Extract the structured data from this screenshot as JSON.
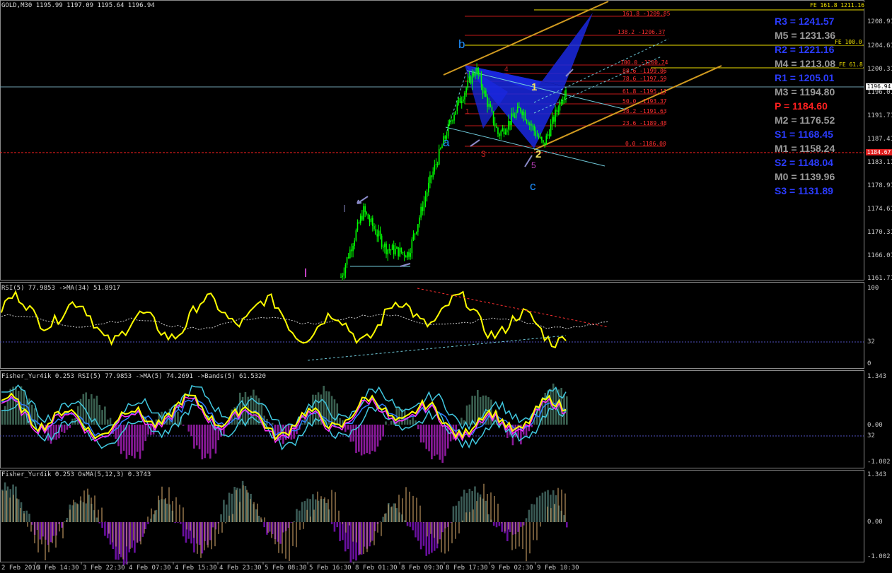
{
  "header": {
    "title": "GOLD,M30  1195.99 1197.09 1195.64 1196.94"
  },
  "colors": {
    "background": "#000000",
    "candle": "#00ff00",
    "pivot_blue": "#1e3cff",
    "pivot_gray": "#a0a0a0",
    "pivot_red": "#ff2020",
    "rsi_line": "#ffff00",
    "channel": "#e0a020",
    "fib": "#ff2020",
    "harmonic_fill": "#1a28e0"
  },
  "pivots": [
    {
      "label": "R3 = 1241.57",
      "color": "#2b3cff"
    },
    {
      "label": "M5 = 1231.36",
      "color": "#9a9a9a"
    },
    {
      "label": "R2 = 1221.16",
      "color": "#2b3cff"
    },
    {
      "label": "M4 = 1213.08",
      "color": "#9a9a9a"
    },
    {
      "label": "R1 = 1205.01",
      "color": "#2b3cff"
    },
    {
      "label": "M3 = 1194.80",
      "color": "#9a9a9a"
    },
    {
      "label": "P   = 1184.60",
      "color": "#ff2020"
    },
    {
      "label": "M2 = 1176.52",
      "color": "#9a9a9a"
    },
    {
      "label": "S1 = 1168.45",
      "color": "#2b3cff"
    },
    {
      "label": "M1 = 1158.24",
      "color": "#9a9a9a"
    },
    {
      "label": "S2 = 1148.04",
      "color": "#2b3cff"
    },
    {
      "label": "M0 = 1139.96",
      "color": "#9a9a9a"
    },
    {
      "label": "S3 = 1131.89",
      "color": "#2b3cff"
    }
  ],
  "fe_labels": [
    {
      "text": "FE  161.8  1211.16"
    },
    {
      "text": "FE  100.0"
    },
    {
      "text": "FE  61.8"
    }
  ],
  "fib_levels": [
    {
      "text": "161.8 -1209.85"
    },
    {
      "text": "138.2 -1206.37"
    },
    {
      "text": "100.0 -1200.74"
    },
    {
      "text": "88.6 -1199.06"
    },
    {
      "text": "78.6 -1197.59"
    },
    {
      "text": "61.8 -1195.11"
    },
    {
      "text": "50.0 -1193.37"
    },
    {
      "text": "38.2 -1191.63"
    },
    {
      "text": "23.6 -1189.48"
    },
    {
      "text": "0.0 -1186.00"
    }
  ],
  "waves": {
    "a": "a",
    "b": "b",
    "c": "c",
    "one": "1",
    "two": "2",
    "three": "3",
    "five": "5",
    "four": "4",
    "small_one": "1"
  },
  "price_axis": [
    "1208.91",
    "1204.61",
    "1200.31",
    "1196.01",
    "1191.71",
    "1187.41",
    "1183.11",
    "1178.91",
    "1174.61",
    "1170.31",
    "1166.01",
    "1161.71"
  ],
  "current_price": "1196.94",
  "pivot_price": "1184.67",
  "rsi_panel": {
    "title": "RSI(5) 77.9853  ->MA(34) 51.8917",
    "axis": [
      "100",
      "32",
      "0"
    ]
  },
  "fisher_panel": {
    "title": "Fisher_Yur4ik 0.253  RSI(5) 77.9853  ->MA(5) 74.2691  ->Bands(5) 61.5320",
    "axis": [
      "1.343",
      "0.00",
      "32",
      "-1.002"
    ]
  },
  "osma_panel": {
    "title": "Fisher_Yur4ik 0.253  OsMA(5,12,3) 0.3743",
    "axis": [
      "1.343",
      "0.00",
      "-1.002"
    ]
  },
  "time_axis": [
    "2 Feb 2016",
    "3 Feb 14:30",
    "3 Feb 22:30",
    "4 Feb 07:30",
    "4 Feb 15:30",
    "4 Feb 23:30",
    "5 Feb 08:30",
    "5 Feb 16:30",
    "8 Feb 01:30",
    "8 Feb 09:30",
    "8 Feb 17:30",
    "9 Feb 02:30",
    "9 Feb 10:30"
  ],
  "chart_data": {
    "type": "line",
    "symbol": "GOLD",
    "timeframe": "M30",
    "ohlc_last": {
      "open": 1195.99,
      "high": 1197.09,
      "low": 1195.64,
      "close": 1196.94
    },
    "ylim": [
      1161.71,
      1211.16
    ],
    "series": [
      {
        "name": "Price",
        "x": [
          "3 Feb 22:30",
          "4 Feb 07:30",
          "4 Feb 15:30",
          "4 Feb 23:30",
          "5 Feb 08:30",
          "5 Feb 16:30",
          "8 Feb 01:30",
          "8 Feb 09:30",
          "8 Feb 17:30",
          "9 Feb 02:30",
          "9 Feb 10:30"
        ],
        "values": [
          1161.7,
          1174.0,
          1167.0,
          1166.0,
          1180.0,
          1192.0,
          1200.3,
          1188.0,
          1193.0,
          1186.0,
          1196.9
        ]
      }
    ],
    "pivots": {
      "R3": 1241.57,
      "M5": 1231.36,
      "R2": 1221.16,
      "M4": 1213.08,
      "R1": 1205.01,
      "M3": 1194.8,
      "P": 1184.6,
      "M2": 1176.52,
      "S1": 1168.45,
      "M1": 1158.24,
      "S2": 1148.04,
      "M0": 1139.96,
      "S3": 1131.89
    },
    "fibonacci": [
      {
        "level": 161.8,
        "price": 1209.85
      },
      {
        "level": 138.2,
        "price": 1206.37
      },
      {
        "level": 100.0,
        "price": 1200.74
      },
      {
        "level": 88.6,
        "price": 1199.06
      },
      {
        "level": 78.6,
        "price": 1197.59
      },
      {
        "level": 61.8,
        "price": 1195.11
      },
      {
        "level": 50.0,
        "price": 1193.37
      },
      {
        "level": 38.2,
        "price": 1191.63
      },
      {
        "level": 23.6,
        "price": 1189.48
      },
      {
        "level": 0.0,
        "price": 1186.0
      }
    ],
    "indicators": {
      "RSI(5)": 77.9853,
      "MA(34)": 51.8917,
      "MA(5)": 74.2691,
      "Bands(5)": 61.532,
      "Fisher_Yur4ik": 0.253,
      "OsMA(5,12,3)": 0.3743
    }
  }
}
